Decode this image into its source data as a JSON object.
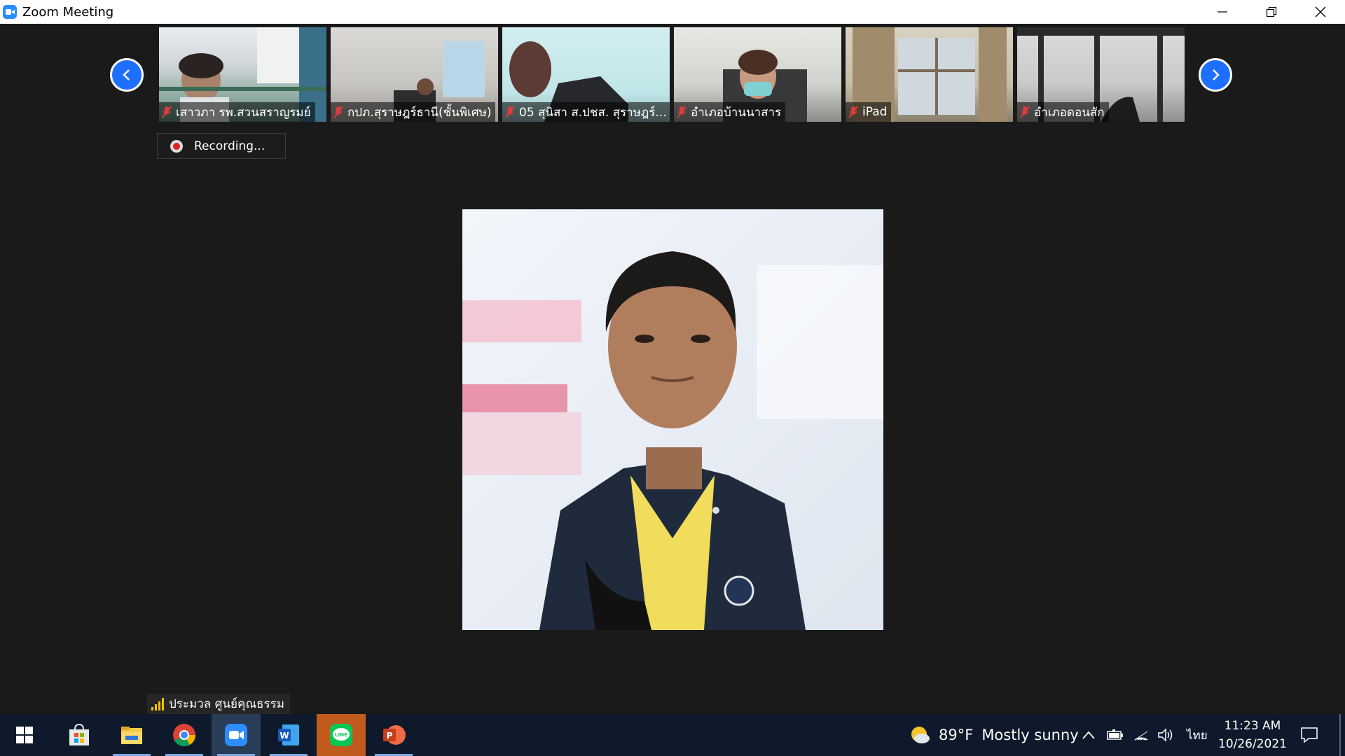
{
  "window": {
    "title": "Zoom Meeting"
  },
  "participants": [
    {
      "name": "เสาวภา รพ.สวนสราญรมย์",
      "muted": true
    },
    {
      "name": "กปภ.สุราษฎร์ธานี(ชั้นพิเศษ)",
      "muted": true
    },
    {
      "name": "05 สุนิสา ส.ปชส. สุราษฎร์...",
      "muted": true
    },
    {
      "name": "อำเภอบ้านนาสาร",
      "muted": true
    },
    {
      "name": "iPad",
      "muted": true
    },
    {
      "name": "อำเภอดอนสัก",
      "muted": true
    }
  ],
  "recording": {
    "label": "Recording..."
  },
  "active_speaker": {
    "name": "ประมวล ศูนย์คุณธรรม"
  },
  "taskbar": {
    "apps": [
      "windows-start",
      "microsoft-store",
      "file-explorer",
      "chrome",
      "zoom",
      "word",
      "line",
      "powerpoint"
    ],
    "weather": {
      "temp": "89°F",
      "condition": "Mostly sunny"
    },
    "language": "ไทย",
    "time": "11:23 AM",
    "date": "10/26/2021"
  },
  "colors": {
    "zoom_blue": "#2d8cff",
    "taskbar_bg": "#0e1a2b",
    "recording_red": "#e02020",
    "signal_yellow": "#f2c200"
  }
}
